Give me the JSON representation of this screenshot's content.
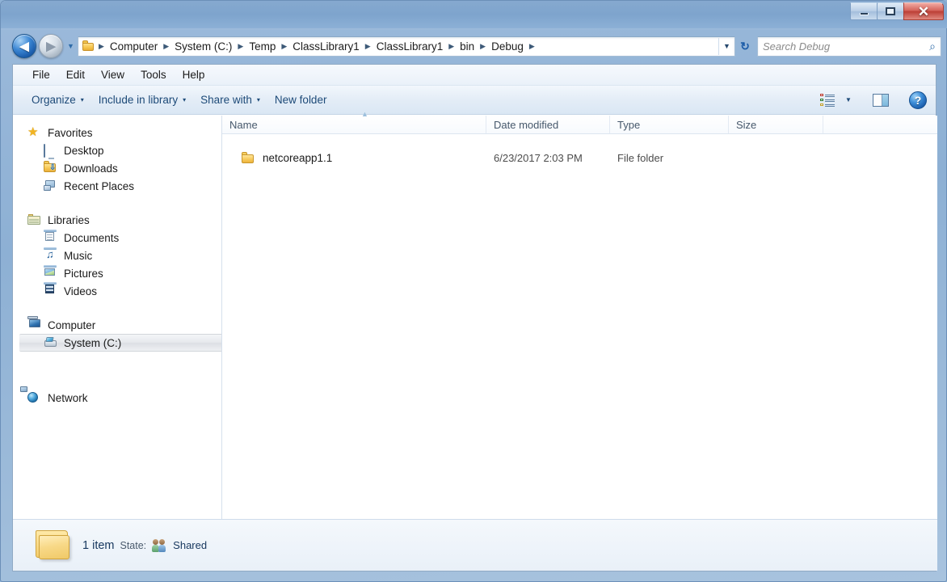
{
  "window": {
    "controls": {
      "minimize": "–",
      "maximize": "□",
      "close": "✕"
    }
  },
  "nav": {
    "back_icon": "◀",
    "forward_icon": "▶",
    "recent_dropdown_icon": "▼",
    "address_dropdown_icon": "▼",
    "refresh_icon": "↻",
    "breadcrumbs": [
      "Computer",
      "System (C:)",
      "Temp",
      "ClassLibrary1",
      "ClassLibrary1",
      "bin",
      "Debug"
    ],
    "separator": "▶",
    "search": {
      "placeholder": "Search Debug",
      "value": "",
      "icon": "⌕"
    }
  },
  "menubar": {
    "items": [
      "File",
      "Edit",
      "View",
      "Tools",
      "Help"
    ]
  },
  "toolbar": {
    "organize": "Organize",
    "include_in_library": "Include in library",
    "share_with": "Share with",
    "new_folder": "New folder",
    "caret": "▾",
    "view_dropdown_caret": "▼",
    "help_glyph": "?"
  },
  "navpane": {
    "favorites": {
      "label": "Favorites",
      "items": [
        "Desktop",
        "Downloads",
        "Recent Places"
      ]
    },
    "libraries": {
      "label": "Libraries",
      "items": [
        "Documents",
        "Music",
        "Pictures",
        "Videos"
      ]
    },
    "computer": {
      "label": "Computer",
      "items": [
        "System (C:)"
      ]
    },
    "network": {
      "label": "Network"
    }
  },
  "listview": {
    "columns": [
      "Name",
      "Date modified",
      "Type",
      "Size"
    ],
    "sort_arrow": "▲",
    "rows": [
      {
        "name": "netcoreapp1.1",
        "date_modified": "6/23/2017 2:03 PM",
        "type": "File folder",
        "size": ""
      }
    ]
  },
  "statusbar": {
    "item_count": "1 item",
    "state_label": "State:",
    "state_value": "Shared"
  },
  "colors": {
    "title_bar": "#7ea4cd",
    "frame": "#8fb2d6",
    "accent_blue": "#1d4a78",
    "close_red": "#bc3f36",
    "folder_yellow": "#f7c957",
    "selection_gray": "#e6e9ed"
  }
}
